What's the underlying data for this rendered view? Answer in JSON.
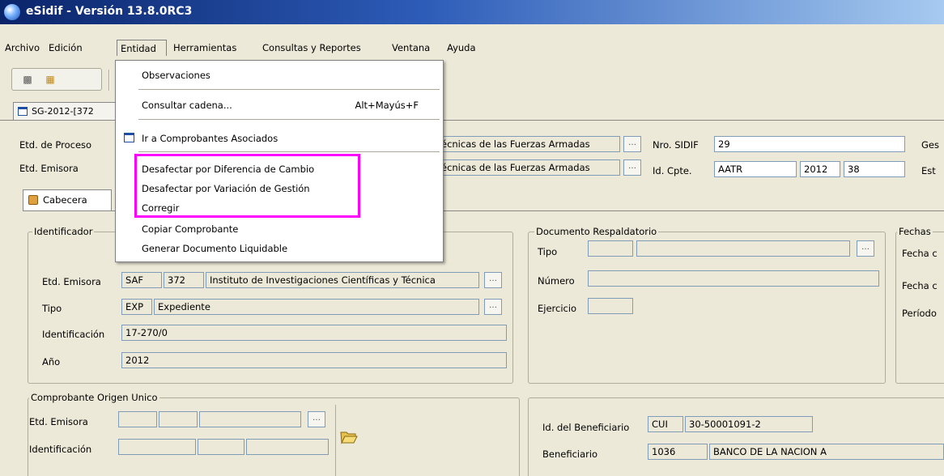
{
  "window": {
    "title": "eSidif - Versión 13.8.0RC3"
  },
  "menubar": {
    "items": [
      {
        "label": "Archivo"
      },
      {
        "label": "Edición"
      },
      {
        "label": "Entidad"
      },
      {
        "label": "Herramientas"
      },
      {
        "label": "Consultas y Reportes"
      },
      {
        "label": "Ventana"
      },
      {
        "label": "Ayuda"
      }
    ]
  },
  "dropdown": {
    "items": [
      {
        "label": "Observaciones"
      },
      {
        "label": "Consultar cadena...",
        "shortcut": "Alt+Mayús+F"
      },
      {
        "label": "Ir a Comprobantes Asociados",
        "icon": "window-icon"
      },
      {
        "label": "Desafectar por Diferencia de Cambio"
      },
      {
        "label": "Desafectar por Variación de Gestión"
      },
      {
        "label": "Corregir"
      },
      {
        "label": "Copiar Comprobante"
      },
      {
        "label": "Generar Documento Liquidable"
      }
    ]
  },
  "document_tab": {
    "label": "SG-2012-[372"
  },
  "header": {
    "etd_proceso_label": "Etd. de Proceso",
    "etd_emisora_label": "Etd. Emisora",
    "etd_proceso_value": "écnicas de las Fuerzas Armadas",
    "etd_emisora_value": "écnicas de las Fuerzas Armadas",
    "nro_sidif_label": "Nro. SIDIF",
    "nro_sidif_value": "29",
    "id_cpte_label": "Id. Cpte.",
    "id_cpte_type": "AATR",
    "id_cpte_year": "2012",
    "id_cpte_num": "38",
    "ges_label": "Ges",
    "est_label": "Est"
  },
  "subtabs": {
    "cabecera": "Cabecera"
  },
  "identificador": {
    "title": "Identificador",
    "etd_emisora_label": "Etd. Emisora",
    "etd_emisora_type": "SAF",
    "etd_emisora_code": "372",
    "etd_emisora_name": "Instituto de Investigaciones Científicas y Técnica",
    "tipo_label": "Tipo",
    "tipo_code": "EXP",
    "tipo_name": "Expediente",
    "identificacion_label": "Identificación",
    "identificacion_value": "17-270/0",
    "anio_label": "Año",
    "anio_value": "2012"
  },
  "documento_respaldatorio": {
    "title": "Documento Respaldatorio",
    "tipo_label": "Tipo",
    "numero_label": "Número",
    "ejercicio_label": "Ejercicio"
  },
  "fechas": {
    "title": "Fechas",
    "fecha1_label": "Fecha c",
    "fecha2_label": "Fecha c",
    "periodo_label": "Período"
  },
  "comprobante_origen": {
    "title": "Comprobante Origen Unico",
    "etd_emisora_label": "Etd. Emisora",
    "identificacion_label": "Identificación"
  },
  "beneficiario": {
    "id_label": "Id. del Beneficiario",
    "id_type": "CUI",
    "id_value": "30-50001091-2",
    "label": "Beneficiario",
    "code": "1036",
    "name": "BANCO DE LA NACION A"
  },
  "colors": {
    "highlight": "#ff00ff",
    "titlebar_start": "#0a246a",
    "titlebar_end": "#a6caf0"
  }
}
